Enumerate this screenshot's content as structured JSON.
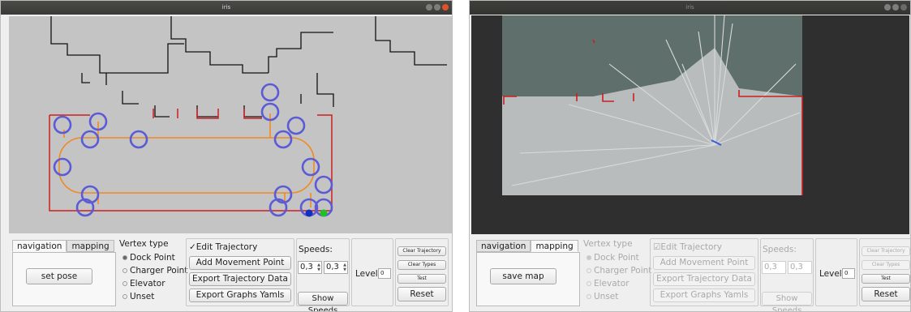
{
  "windows": [
    {
      "title": "iris",
      "tabs": [
        "navigation",
        "mapping"
      ],
      "active_tab": "navigation",
      "tab_button": "set pose",
      "vertex_type": {
        "title": "Vertex type",
        "options": [
          "Dock Point",
          "Charger Point",
          "Elevator",
          "Unset"
        ],
        "selected": "Dock Point"
      },
      "trajectory": {
        "edit_check": "✓Edit Trajectory",
        "add_point": "Add Movement Point",
        "export_traj": "Export Trajectory Data",
        "export_graphs": "Export Graphs Yamls"
      },
      "speeds": {
        "label": "Speeds:",
        "v1": "0,3",
        "v2": "0,3",
        "show": "Show Speeds"
      },
      "level": {
        "label": "Level:",
        "value": "0"
      },
      "right_buttons": {
        "clear_traj": "Clear Trajectory",
        "clear_types": "Clear Types",
        "test": "Test",
        "reset": "Reset"
      },
      "enabled": true
    },
    {
      "title": "iris",
      "tabs": [
        "navigation",
        "mapping"
      ],
      "active_tab": "mapping",
      "tab_button": "save map",
      "vertex_type": {
        "title": "Vertex type",
        "options": [
          "Dock Point",
          "Charger Point",
          "Elevator",
          "Unset"
        ],
        "selected": "Dock Point"
      },
      "trajectory": {
        "edit_check": "☑Edit Trajectory",
        "add_point": "Add Movement Point",
        "export_traj": "Export Trajectory Data",
        "export_graphs": "Export Graphs Yamls"
      },
      "speeds": {
        "label": "Speeds:",
        "v1": "0,3",
        "v2": "0,3",
        "show": "Show Speeds"
      },
      "level": {
        "label": "Level:",
        "value": "0"
      },
      "right_buttons": {
        "clear_traj": "Clear Trajectory",
        "clear_types": "Clear Types",
        "test": "Test",
        "reset": "Reset"
      },
      "enabled": false
    }
  ],
  "colors": {
    "trajectory": "#f08a24",
    "waypoint": "#5b5bd6",
    "wall": "#cc1f1f",
    "start_marker": "#1030c0",
    "end_marker": "#22c022"
  }
}
